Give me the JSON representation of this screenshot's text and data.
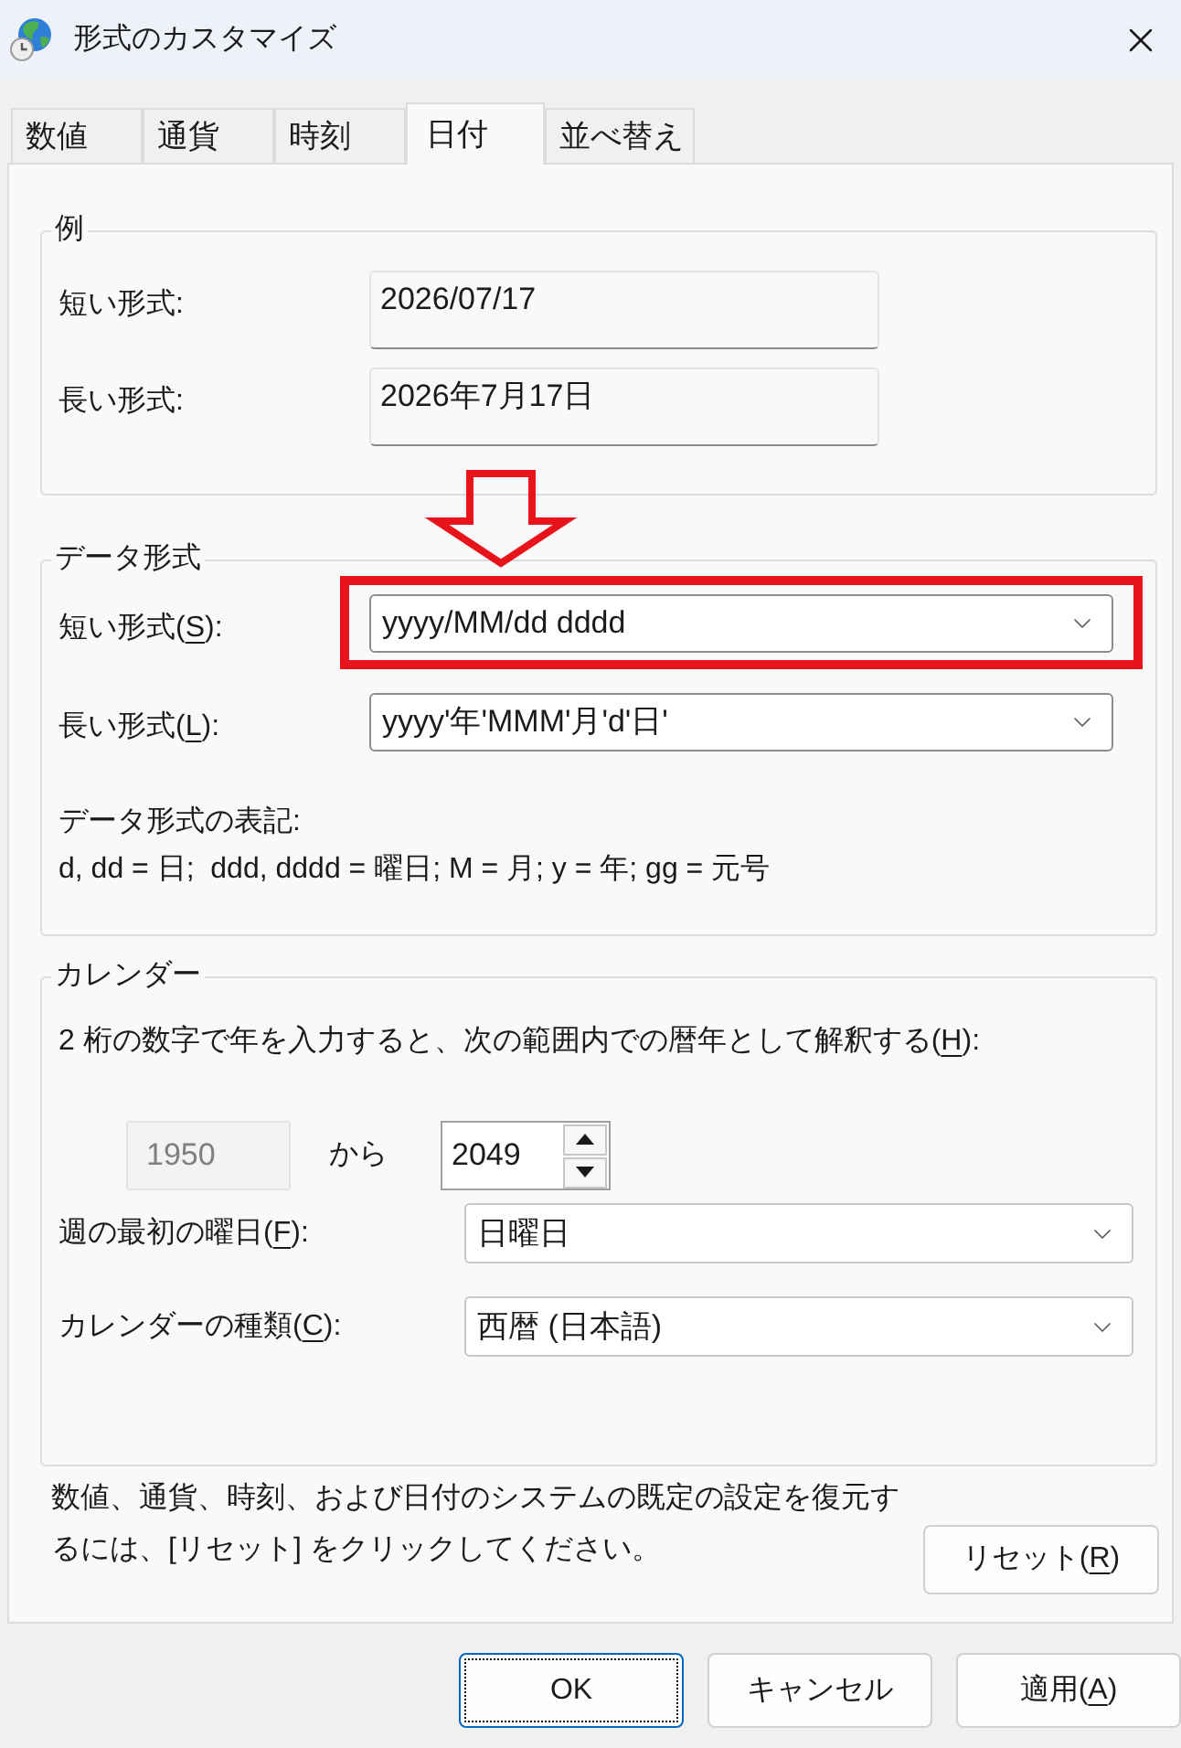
{
  "window": {
    "title": "形式のカスタマイズ"
  },
  "tabs": [
    {
      "label": "数値",
      "selected": false
    },
    {
      "label": "通貨",
      "selected": false
    },
    {
      "label": "時刻",
      "selected": false
    },
    {
      "label": "日付",
      "selected": true
    },
    {
      "label": "並べ替え",
      "selected": false
    }
  ],
  "example": {
    "title": "例",
    "rows": [
      {
        "label": "短い形式:",
        "value": "2026/07/17"
      },
      {
        "label": "長い形式:",
        "value": "2026年7月17日"
      }
    ]
  },
  "date_formats": {
    "title": "データ形式",
    "pointer_arrow": true,
    "rows": [
      {
        "label": [
          {
            "text": "短い形式(",
            "underline": false
          },
          {
            "text": "S",
            "underline": true
          },
          {
            "text": "):",
            "underline": false
          }
        ],
        "value": "yyyy/MM/dd dddd",
        "highlighted": true
      },
      {
        "label": [
          {
            "text": "長い形式(",
            "underline": false
          },
          {
            "text": "L",
            "underline": true
          },
          {
            "text": "):",
            "underline": false
          }
        ],
        "value": "yyyy'年'MMM'月'd'日'",
        "highlighted": false
      }
    ],
    "notation_title": "データ形式の表記:",
    "notation": "d, dd = 日;  ddd, dddd = 曜日; M = 月; y = 年; gg = 元号"
  },
  "calendar": {
    "title": "カレンダー",
    "two_digit_year": {
      "label": [
        {
          "text": "2 桁の数字で年を入力すると、次の範囲内での暦年として解釈する(",
          "underline": false
        },
        {
          "text": "H",
          "underline": true
        },
        {
          "text": "):",
          "underline": false
        }
      ],
      "from": {
        "value": "1950",
        "disabled": true
      },
      "range_word": "から",
      "to": {
        "value": "2049"
      }
    },
    "rows": [
      {
        "label": [
          {
            "text": "週の最初の曜日(",
            "underline": false
          },
          {
            "text": "F",
            "underline": true
          },
          {
            "text": "):",
            "underline": false
          }
        ],
        "value": "日曜日"
      },
      {
        "label": [
          {
            "text": "カレンダーの種類(",
            "underline": false
          },
          {
            "text": "C",
            "underline": true
          },
          {
            "text": "):",
            "underline": false
          }
        ],
        "value": "西暦 (日本語)"
      }
    ]
  },
  "reset": {
    "text": "数値、通貨、時刻、および日付のシステムの既定の設定を復元するには、[リセット] をクリックしてください。",
    "button": {
      "label": [
        {
          "text": "リセット(",
          "underline": false
        },
        {
          "text": "R",
          "underline": true
        },
        {
          "text": ")",
          "underline": false
        }
      ]
    }
  },
  "buttons": [
    {
      "label": [
        {
          "text": "OK",
          "underline": false
        }
      ],
      "default": true
    },
    {
      "label": [
        {
          "text": "キャンセル",
          "underline": false
        }
      ],
      "default": false
    },
    {
      "label": [
        {
          "text": "適用(",
          "underline": false
        },
        {
          "text": "A",
          "underline": true
        },
        {
          "text": ")",
          "underline": false
        }
      ],
      "default": false
    }
  ]
}
